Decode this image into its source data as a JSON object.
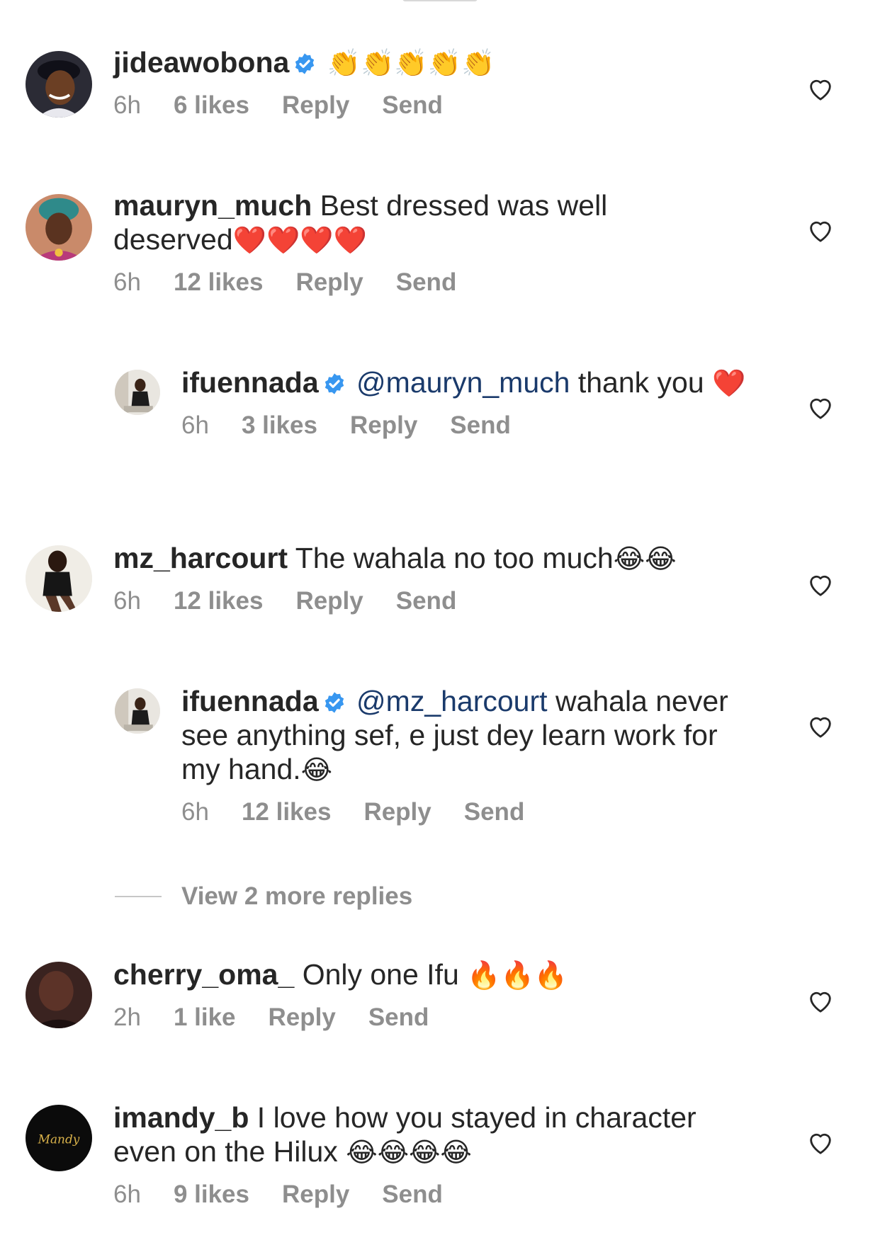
{
  "comments": [
    {
      "id": "c1",
      "username": "jideawobona",
      "verified": true,
      "text": "",
      "mention": "",
      "emoji": "👏👏👏👏👏",
      "time": "6h",
      "likes": "6 likes",
      "reply": "Reply",
      "send": "Send",
      "avatar": "avatar-man-cap"
    },
    {
      "id": "c2",
      "username": "mauryn_much",
      "verified": false,
      "text": "Best dressed was well deserved",
      "mention": "",
      "emoji": "❤️❤️❤️❤️",
      "time": "6h",
      "likes": "12 likes",
      "reply": "Reply",
      "send": "Send",
      "avatar": "avatar-woman-headwrap"
    },
    {
      "id": "c3",
      "username": "ifuennada",
      "verified": true,
      "mention": "@mauryn_much",
      "text": "thank you",
      "emoji": "❤️",
      "time": "6h",
      "likes": "3 likes",
      "reply": "Reply",
      "send": "Send",
      "avatar": "avatar-woman-room"
    },
    {
      "id": "c4",
      "username": "mz_harcourt",
      "verified": false,
      "mention": "",
      "text": "The wahala no too much",
      "emoji": "😂😂",
      "time": "6h",
      "likes": "12 likes",
      "reply": "Reply",
      "send": "Send",
      "avatar": "avatar-woman-pose"
    },
    {
      "id": "c5",
      "username": "ifuennada",
      "verified": true,
      "mention": "@mz_harcourt",
      "text": "wahala never see anything sef, e just dey learn work for my hand.",
      "emoji": "😂",
      "time": "6h",
      "likes": "12 likes",
      "reply": "Reply",
      "send": "Send",
      "avatar": "avatar-woman-room"
    },
    {
      "id": "c6",
      "username": "cherry_oma_",
      "verified": false,
      "mention": "",
      "text": "Only one Ifu",
      "emoji": "🔥🔥🔥",
      "time": "2h",
      "likes": "1 like",
      "reply": "Reply",
      "send": "Send",
      "avatar": "avatar-dark"
    },
    {
      "id": "c7",
      "username": "imandy_b",
      "verified": false,
      "mention": "",
      "text": "I love how you stayed in character even on the Hilux",
      "emoji": "😂😂😂😂",
      "time": "6h",
      "likes": "9 likes",
      "reply": "Reply",
      "send": "Send",
      "avatar": "avatar-mandy-logo",
      "avatar_text": "Mandy"
    }
  ],
  "view_more": "View 2 more replies",
  "colors": {
    "text": "#262626",
    "meta": "#8e8e8e",
    "mention": "#1a3a6b",
    "verified": "#3897f0"
  }
}
